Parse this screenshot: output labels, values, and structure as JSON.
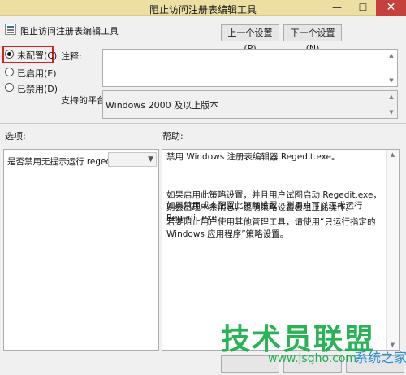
{
  "window": {
    "title": "阻止访问注册表编辑工具",
    "minimize_glyph": "—",
    "maximize_glyph": "☐",
    "close_glyph": "✕"
  },
  "header": {
    "icon": "policy-setting-icon",
    "label": "阻止访问注册表编辑工具",
    "prev_button": "上一个设置(P)",
    "next_button": "下一个设置(N)"
  },
  "state": {
    "options": [
      {
        "label": "未配置(C)",
        "checked": true
      },
      {
        "label": "已启用(E)",
        "checked": false
      },
      {
        "label": "已禁用(D)",
        "checked": false
      }
    ],
    "highlight_color": "#d81e1e"
  },
  "comment": {
    "label": "注释:",
    "value": ""
  },
  "platform": {
    "label": "支持的平台:",
    "value": "Windows 2000 及以上版本"
  },
  "options_section": {
    "label": "选项:",
    "item_label": "是否禁用无提示运行 regedit?",
    "select_value": ""
  },
  "help_section": {
    "label": "帮助:",
    "paragraphs": [
      "禁用 Windows 注册表编辑器 Regedit.exe。",
      "如果启用此策略设置，并且用户试图启动 Regedit.exe，则会出现一条消息，说明策略设置会阻止此操作。",
      "如果禁用或未配置此策略设置，则用户可以正常运行 Regedit.exe。",
      "若要阻止用户使用其他管理工具，请使用“只运行指定的 Windows 应用程序”策略设置。"
    ]
  },
  "watermark": {
    "main": "技术员联盟",
    "url": "www.jsgho.com",
    "extra": "系统之家"
  },
  "colors": {
    "titlebar": "#eddfa3",
    "close": "#c4413c",
    "watermark_green": "#1fae4f"
  }
}
